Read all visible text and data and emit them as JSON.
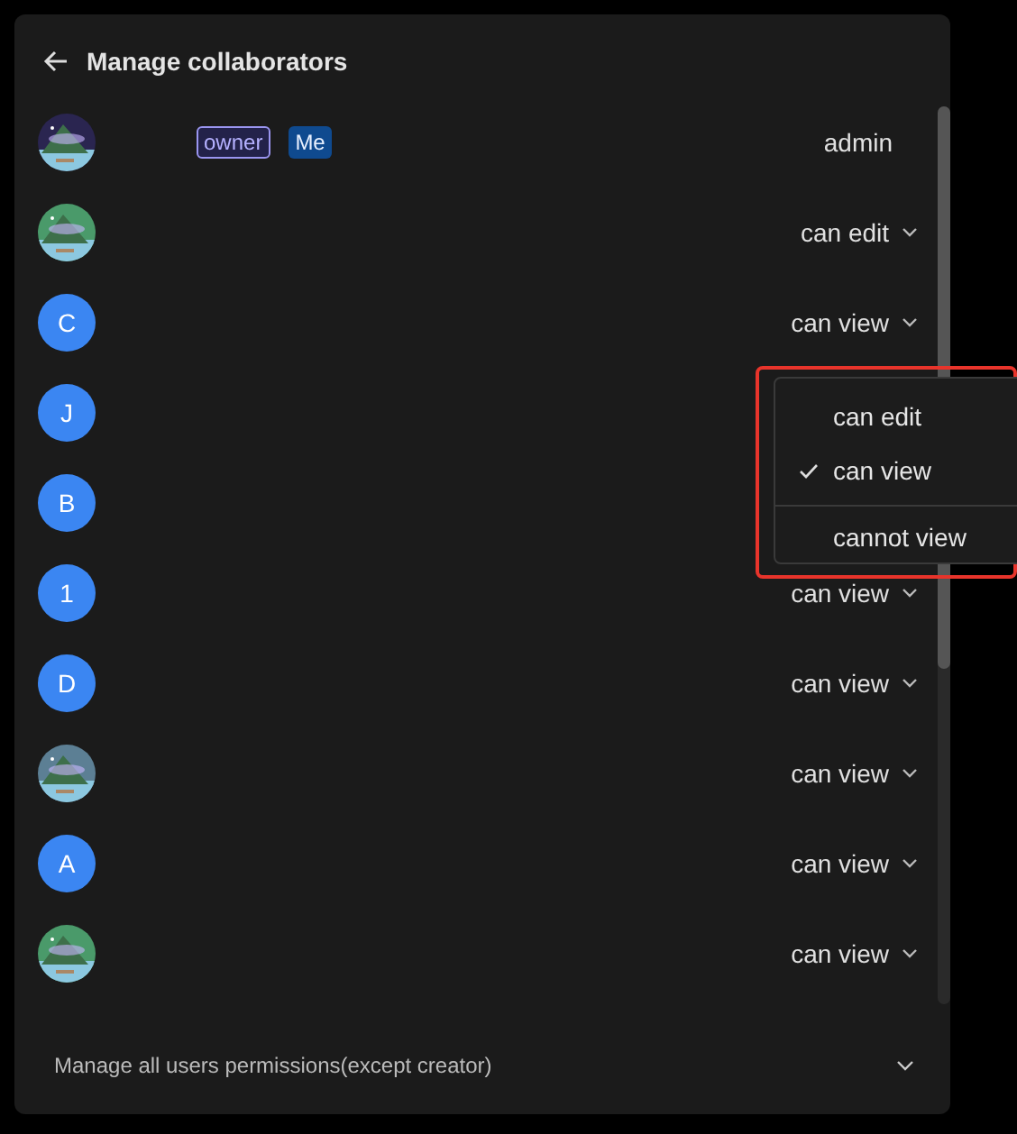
{
  "header": {
    "title": "Manage collaborators"
  },
  "collaborators": [
    {
      "avatar": {
        "kind": "picture"
      },
      "badges": [
        "owner",
        "Me"
      ],
      "permission": "admin",
      "dropdown": false
    },
    {
      "avatar": {
        "kind": "picture"
      },
      "permission": "can edit",
      "dropdown": true
    },
    {
      "avatar": {
        "kind": "letter",
        "letter": "C"
      },
      "permission": "can view",
      "dropdown": true
    },
    {
      "avatar": {
        "kind": "letter",
        "letter": "J"
      }
    },
    {
      "avatar": {
        "kind": "letter",
        "letter": "B"
      }
    },
    {
      "avatar": {
        "kind": "letter",
        "letter": "1"
      },
      "permission": "can view",
      "dropdown": true
    },
    {
      "avatar": {
        "kind": "letter",
        "letter": "D"
      },
      "permission": "can view",
      "dropdown": true
    },
    {
      "avatar": {
        "kind": "picture"
      },
      "permission": "can view",
      "dropdown": true
    },
    {
      "avatar": {
        "kind": "letter",
        "letter": "A"
      },
      "permission": "can view",
      "dropdown": true
    },
    {
      "avatar": {
        "kind": "picture"
      },
      "permission": "can view",
      "dropdown": true
    }
  ],
  "permission_menu": {
    "items": [
      {
        "label": "can edit",
        "selected": false
      },
      {
        "label": "can view",
        "selected": true
      },
      {
        "label": "cannot view",
        "selected": false
      }
    ]
  },
  "footer": {
    "label": "Manage all users permissions(except creator)"
  }
}
